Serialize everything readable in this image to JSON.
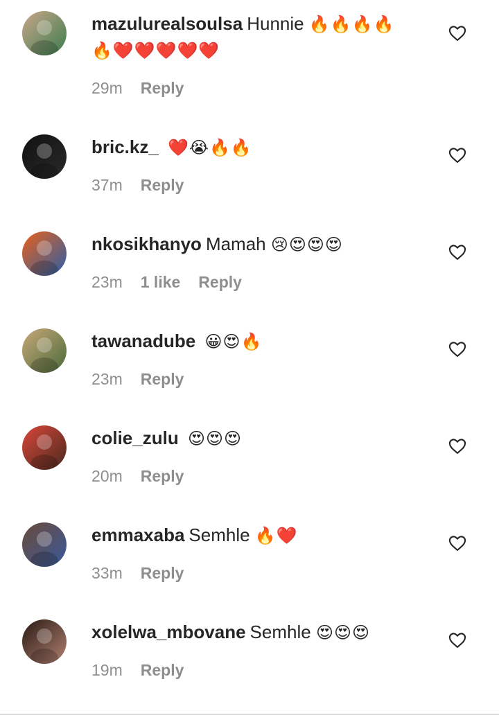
{
  "comments": [
    {
      "username": "mazulurealsoulsa",
      "text": "Hunnie",
      "emoji_line1": "🔥🔥🔥🔥",
      "emoji_line2": "🔥❤️❤️❤️❤️❤️",
      "time": "29m",
      "likes": "",
      "reply": "Reply",
      "avatar_colors": [
        "#c9a58a",
        "#3b7d4e"
      ]
    },
    {
      "username": "bric.kz_",
      "text": "",
      "emoji_line1": "❤️😭🔥🔥",
      "emoji_line2": "",
      "time": "37m",
      "likes": "",
      "reply": "Reply",
      "avatar_colors": [
        "#111111",
        "#2a2a2a"
      ]
    },
    {
      "username": "nkosikhanyo",
      "text": "Mamah",
      "emoji_line1": "😢😍😍😍",
      "emoji_line2": "",
      "time": "23m",
      "likes": "1 like",
      "reply": "Reply",
      "avatar_colors": [
        "#e8601a",
        "#2b5fa8"
      ]
    },
    {
      "username": "tawanadube",
      "text": "",
      "emoji_line1": "😀😍🔥",
      "emoji_line2": "",
      "time": "23m",
      "likes": "",
      "reply": "Reply",
      "avatar_colors": [
        "#c8a878",
        "#4a6a3a"
      ]
    },
    {
      "username": "colie_zulu",
      "text": "",
      "emoji_line1": "😍😍😍",
      "emoji_line2": "",
      "time": "20m",
      "likes": "",
      "reply": "Reply",
      "avatar_colors": [
        "#d9463a",
        "#4a2a1e"
      ]
    },
    {
      "username": "emmaxaba",
      "text": "Semhle",
      "emoji_line1": "🔥❤️",
      "emoji_line2": "",
      "time": "33m",
      "likes": "",
      "reply": "Reply",
      "avatar_colors": [
        "#6a4a3a",
        "#3a5a9a"
      ]
    },
    {
      "username": "xolelwa_mbovane",
      "text": "Semhle",
      "emoji_line1": "😍😍😍",
      "emoji_line2": "",
      "time": "19m",
      "likes": "",
      "reply": "Reply",
      "avatar_colors": [
        "#2a1a14",
        "#b08070"
      ]
    }
  ],
  "colors": {
    "text": "#262626",
    "meta": "#8e8e8e",
    "divider": "#dbdbdb"
  },
  "icons": {
    "like": "heart-outline-icon"
  }
}
